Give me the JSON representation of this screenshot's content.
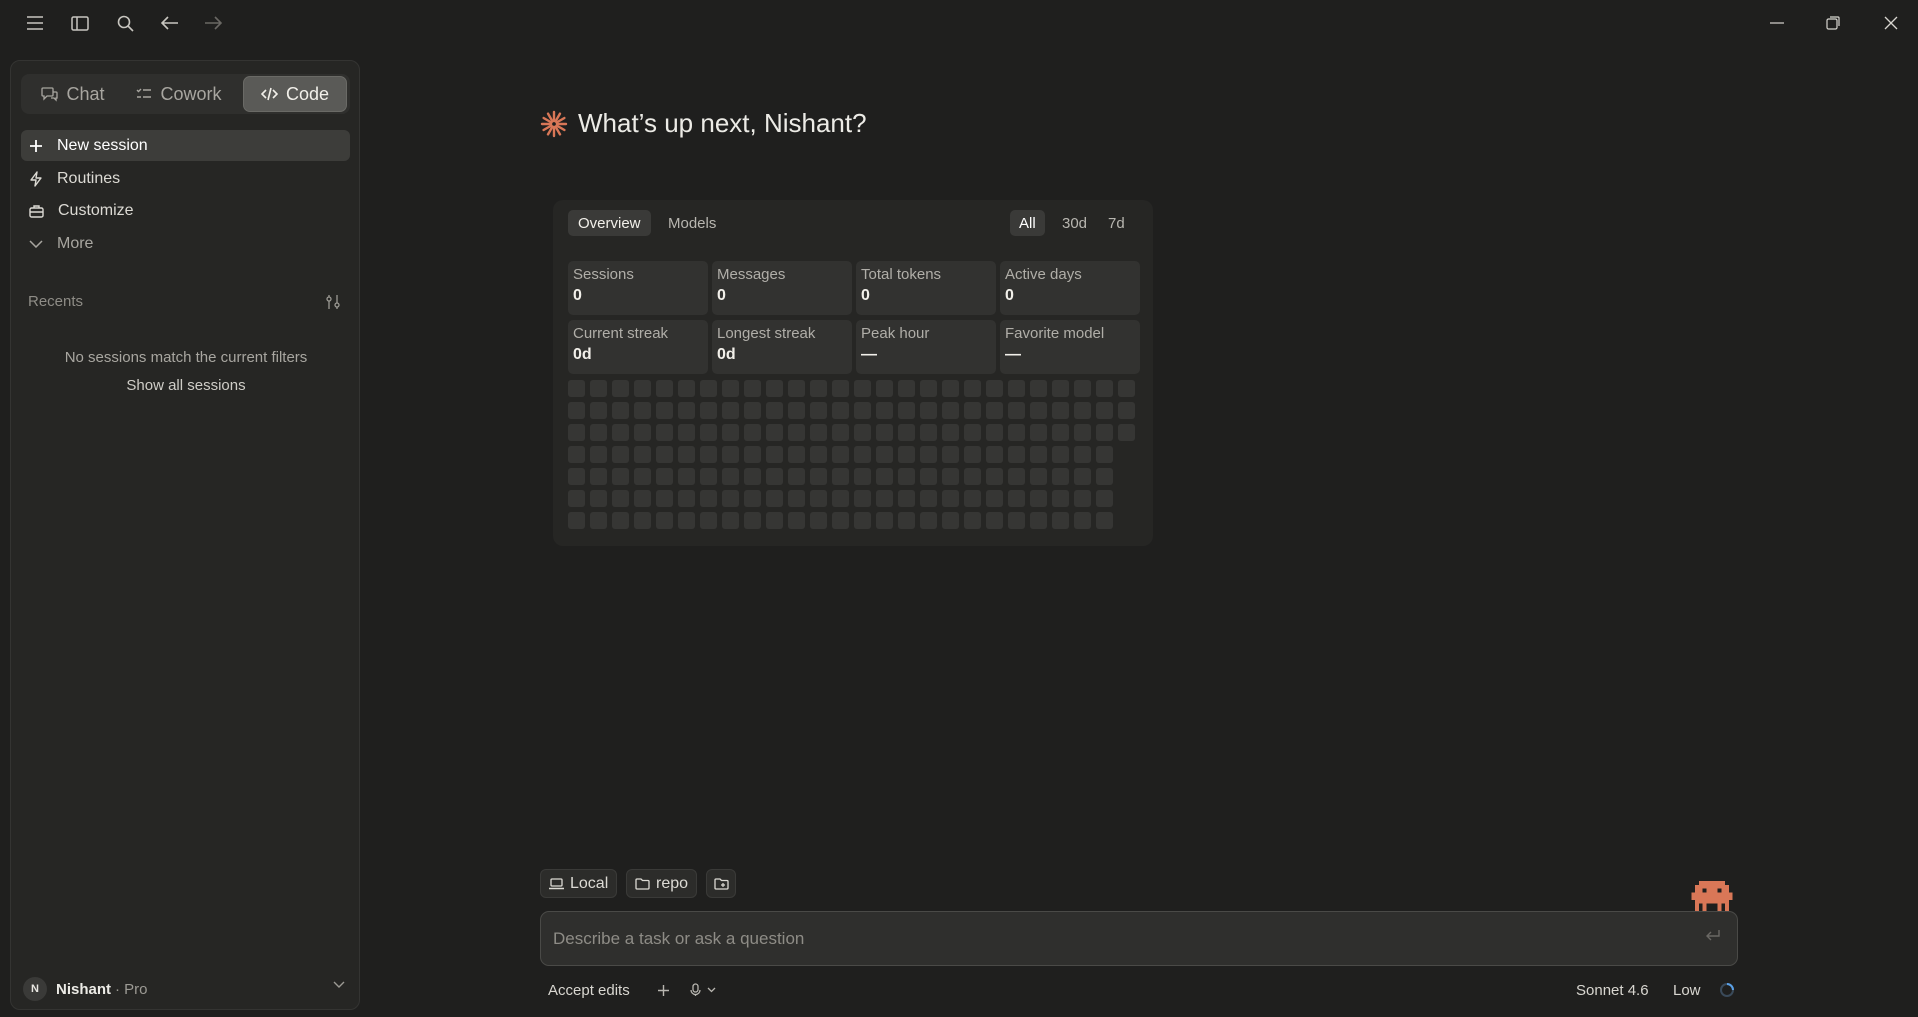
{
  "sidebar": {
    "modes": [
      {
        "label": "Chat",
        "icon": "chat-bubbles-icon"
      },
      {
        "label": "Cowork",
        "icon": "cowork-list-icon"
      },
      {
        "label": "Code",
        "icon": "code-icon",
        "active": true
      }
    ],
    "nav": [
      {
        "label": "New session",
        "icon": "plus-icon"
      },
      {
        "label": "Routines",
        "icon": "lightning-icon"
      },
      {
        "label": "Customize",
        "icon": "briefcase-icon"
      },
      {
        "label": "More",
        "icon": "chevron-down-icon"
      }
    ],
    "recents_label": "Recents",
    "empty_message": "No sessions match the current filters",
    "show_all": "Show all sessions",
    "user": {
      "initial": "N",
      "name": "Nishant",
      "plan": "· Pro"
    }
  },
  "main": {
    "greeting": "What’s up next, Nishant?",
    "stats": {
      "tabs": [
        "Overview",
        "Models"
      ],
      "ranges": [
        "All",
        "30d",
        "7d"
      ],
      "cards": [
        {
          "label": "Sessions",
          "value": "0"
        },
        {
          "label": "Messages",
          "value": "0"
        },
        {
          "label": "Total tokens",
          "value": "0"
        },
        {
          "label": "Active days",
          "value": "0"
        },
        {
          "label": "Current streak",
          "value": "0d"
        },
        {
          "label": "Longest streak",
          "value": "0d"
        },
        {
          "label": "Peak hour",
          "value": "—"
        },
        {
          "label": "Favorite model",
          "value": "—"
        }
      ]
    }
  },
  "composer": {
    "env_label": "Local",
    "repo_label": "repo",
    "placeholder": "Describe a task or ask a question",
    "accept_edits": "Accept edits",
    "model": "Sonnet 4.6",
    "effort": "Low"
  },
  "colors": {
    "accent": "#d97757",
    "background": "#1f1f1e",
    "sidebar": "#262624"
  }
}
